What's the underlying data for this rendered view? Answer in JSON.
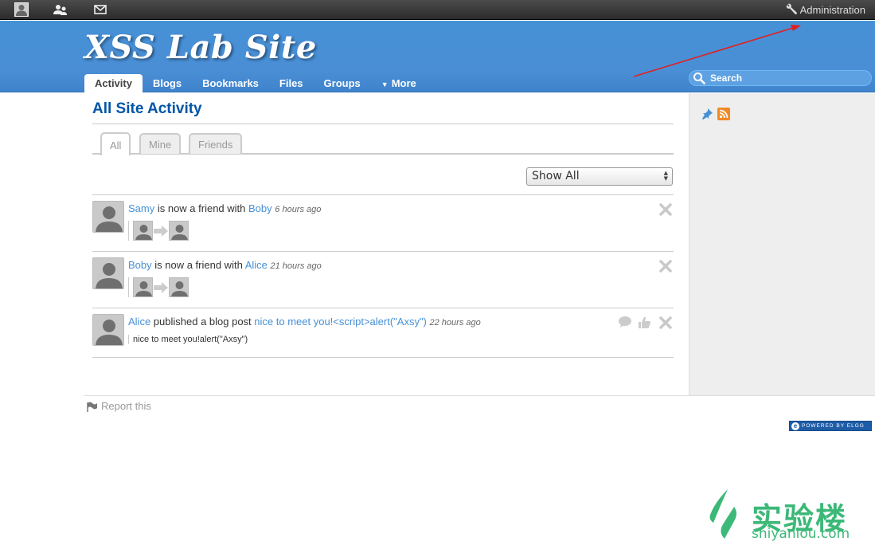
{
  "topbar": {
    "admin_label": "Administration"
  },
  "header": {
    "site_title": "XSS Lab Site",
    "nav": [
      {
        "label": "Activity",
        "active": true
      },
      {
        "label": "Blogs"
      },
      {
        "label": "Bookmarks"
      },
      {
        "label": "Files"
      },
      {
        "label": "Groups"
      },
      {
        "label": "More",
        "arrow": "▼"
      }
    ],
    "search_placeholder": "Search"
  },
  "main": {
    "title": "All Site Activity",
    "tabs": [
      {
        "label": "All",
        "active": true
      },
      {
        "label": "Mine"
      },
      {
        "label": "Friends"
      }
    ],
    "filter_value": "Show All"
  },
  "river": [
    {
      "subject": "Samy",
      "verb": " is now a friend with ",
      "object": "Boby",
      "time": "6 hours ago"
    },
    {
      "subject": "Boby",
      "verb": " is now a friend with ",
      "object": "Alice",
      "time": "21 hours ago"
    },
    {
      "subject": "Alice",
      "verb": " published a blog post ",
      "object": "nice to meet you!<script>alert(\"Axsy\")",
      "time": "22 hours ago",
      "excerpt": "nice to meet you!alert(\"Axsy\")"
    }
  ],
  "footer": {
    "report_label": "Report this",
    "powered_label": "POWERED BY ELGG"
  },
  "watermark": {
    "cn": "实验楼",
    "en": "shiyanlou.com"
  },
  "colors": {
    "header_blue": "#4690d6",
    "link_blue": "#4690d6",
    "title_blue": "#0054a7",
    "annotation_red": "#e02020",
    "watermark_green": "#3cb878"
  }
}
